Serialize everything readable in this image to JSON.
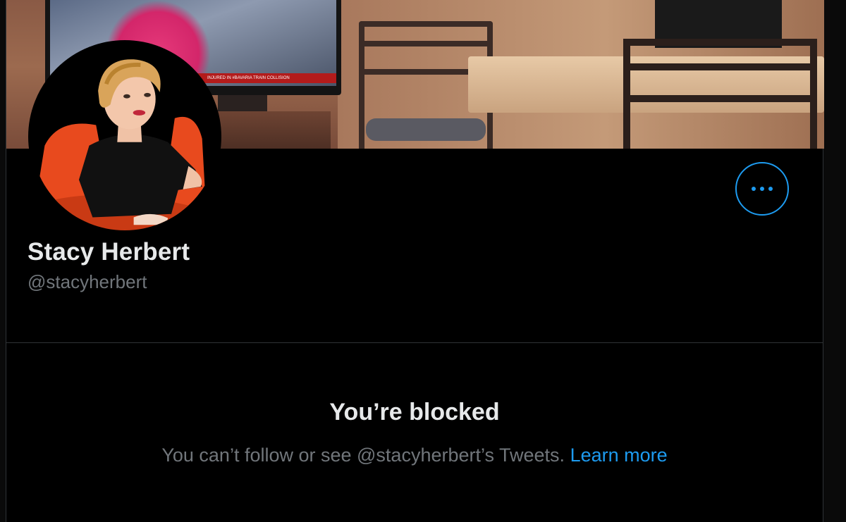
{
  "profile": {
    "display_name": "Stacy Herbert",
    "handle": "@stacyherbert"
  },
  "banner": {
    "tv_ticker_text": "INJURED IN #BAVARIA TRAIN COLLISION"
  },
  "actions": {
    "more_icon": "more-horizontal-icon"
  },
  "blocked": {
    "title": "You’re blocked",
    "message": "You can’t follow or see @stacyherbert’s Tweets.",
    "link_label": "Learn more"
  },
  "colors": {
    "accent": "#1d9bf0",
    "background": "#000000",
    "primary_text": "#e7e9ea",
    "secondary_text": "#71767b",
    "border": "#2f3336"
  }
}
